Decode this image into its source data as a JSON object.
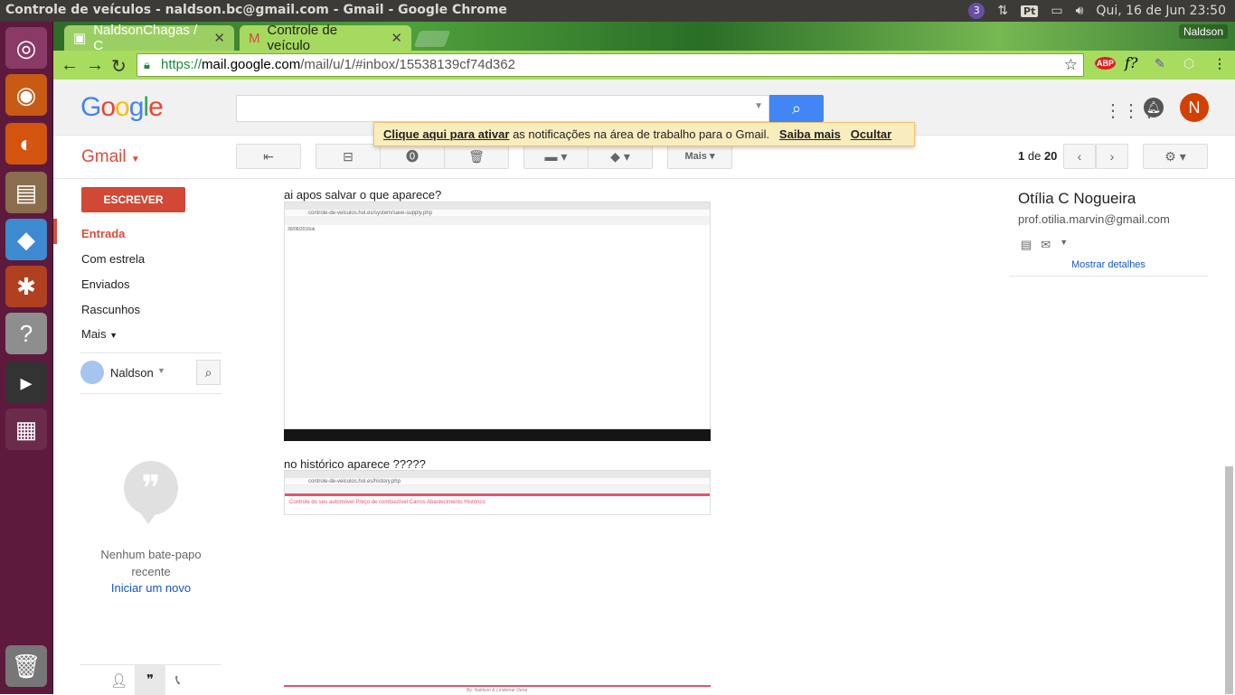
{
  "system": {
    "window_title": "Controle de veículos - naldson.bc@gmail.com - Gmail - Google Chrome",
    "workspace_badge": "3",
    "keyboard_layout": "Pt",
    "datetime": "Qui, 16 de Jun 23:50"
  },
  "browser": {
    "tabs": [
      {
        "label": "NaldsonChagas / C"
      },
      {
        "label": "Controle de veículo"
      }
    ],
    "profile": "Naldson",
    "url_scheme": "https://",
    "url_host": "mail.google.com",
    "url_path": "/mail/u/1/#inbox/15538139cf74d362",
    "extensions": [
      "ABP",
      "f?"
    ]
  },
  "gmail": {
    "logo": {
      "G": "G",
      "o1": "o",
      "o2": "o",
      "g": "g",
      "l": "l",
      "e": "e"
    },
    "label": "Gmail",
    "notification": {
      "link": "Clique aqui para ativar",
      "text": "as notificações na área de trabalho para o Gmail.",
      "learn_more": "Saiba mais",
      "hide": "Ocultar"
    },
    "toolbar": {
      "more": "Mais"
    },
    "pager": {
      "range": "1",
      "of": "de",
      "total": "20"
    },
    "avatar_initial": "N",
    "compose": "ESCREVER",
    "nav": [
      {
        "label": "Entrada"
      },
      {
        "label": "Com estrela"
      },
      {
        "label": "Enviados"
      },
      {
        "label": "Rascunhos"
      },
      {
        "label": "Mais"
      }
    ],
    "hangouts": {
      "user": "Naldson",
      "empty": "Nenhum bate-papo recente",
      "start": "Iniciar um novo"
    }
  },
  "message": {
    "text1": "ai apos salvar o que aparece?",
    "shot1_url": "controle-de-veiculos.hol.es/system/save-supply.php",
    "shot1_content": "30/06/2016ok",
    "text2": "no histórico aparece ?????",
    "shot2_url": "controle-de-veiculos.hol.es/history.php",
    "shot2_menu": "Controle do seu automóvel    Preço de combustível    Carros    Abastecimento    Histórico",
    "byline": "By: Naldson & Lindomar Dena"
  },
  "contact": {
    "name": "Otília C Nogueira",
    "email": "prof.otilia.marvin@gmail.com",
    "details": "Mostrar detalhes"
  }
}
